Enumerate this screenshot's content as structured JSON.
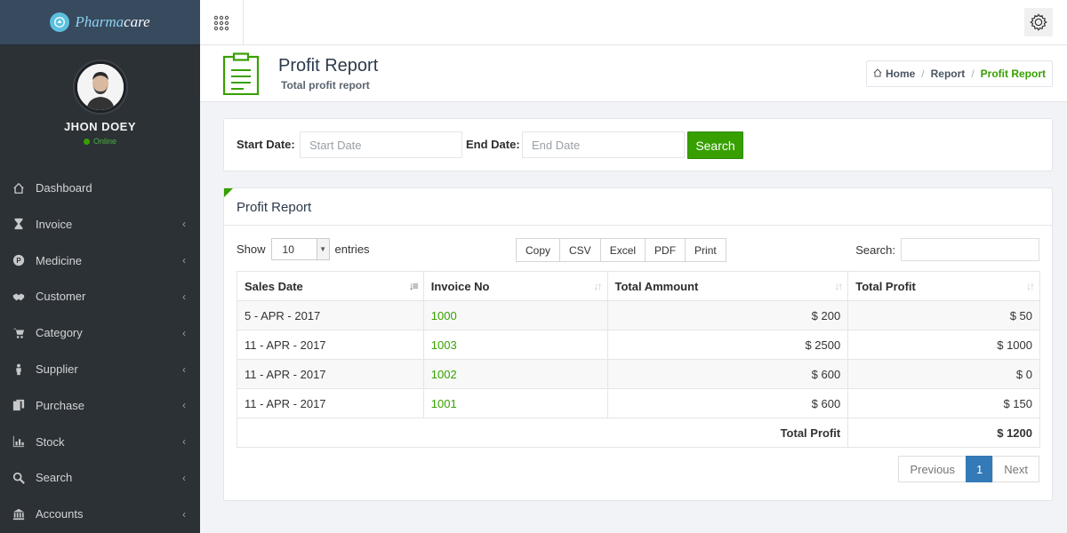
{
  "brand": {
    "name_part1": "Pharma",
    "name_part2": "care"
  },
  "user": {
    "name": "JHON DOEY",
    "status": "Online"
  },
  "sidebar": {
    "items": [
      {
        "label": "Dashboard",
        "icon": "home-icon",
        "chevron": false
      },
      {
        "label": "Invoice",
        "icon": "hourglass-icon",
        "chevron": true
      },
      {
        "label": "Medicine",
        "icon": "pill-circle-icon",
        "chevron": true
      },
      {
        "label": "Customer",
        "icon": "handshake-icon",
        "chevron": true
      },
      {
        "label": "Category",
        "icon": "cart-icon",
        "chevron": true
      },
      {
        "label": "Supplier",
        "icon": "person-icon",
        "chevron": true
      },
      {
        "label": "Purchase",
        "icon": "copy-icon",
        "chevron": true
      },
      {
        "label": "Stock",
        "icon": "bar-chart-icon",
        "chevron": true
      },
      {
        "label": "Search",
        "icon": "search-icon",
        "chevron": true
      },
      {
        "label": "Accounts",
        "icon": "bank-icon",
        "chevron": true
      }
    ]
  },
  "header": {
    "title": "Profit Report",
    "subtitle": "Total profit report",
    "breadcrumb": {
      "home": "Home",
      "report": "Report",
      "current": "Profit Report"
    }
  },
  "filter": {
    "start_label": "Start Date:",
    "start_placeholder": "Start Date",
    "end_label": "End Date:",
    "end_placeholder": "End Date",
    "search_button": "Search"
  },
  "report": {
    "title": "Profit Report",
    "show_label": "Show",
    "entries_value": "10",
    "entries_label": "entries",
    "export_buttons": [
      "Copy",
      "CSV",
      "Excel",
      "PDF",
      "Print"
    ],
    "search_label": "Search:",
    "columns": [
      "Sales Date",
      "Invoice No",
      "Total Ammount",
      "Total Profit"
    ],
    "rows": [
      {
        "date": "5 - APR - 2017",
        "invoice": "1000",
        "amount": "$ 200",
        "profit": "$ 50"
      },
      {
        "date": "11 - APR - 2017",
        "invoice": "1003",
        "amount": "$ 2500",
        "profit": "$ 1000"
      },
      {
        "date": "11 - APR - 2017",
        "invoice": "1002",
        "amount": "$ 600",
        "profit": "$ 0"
      },
      {
        "date": "11 - APR - 2017",
        "invoice": "1001",
        "amount": "$ 600",
        "profit": "$ 150"
      }
    ],
    "total_label": "Total Profit",
    "total_value": "$ 1200",
    "pagination": {
      "previous": "Previous",
      "current_page": "1",
      "next": "Next"
    }
  },
  "colors": {
    "accent": "#37a000",
    "sidebar_bg": "#2c3136",
    "page_active": "#337ab7"
  }
}
